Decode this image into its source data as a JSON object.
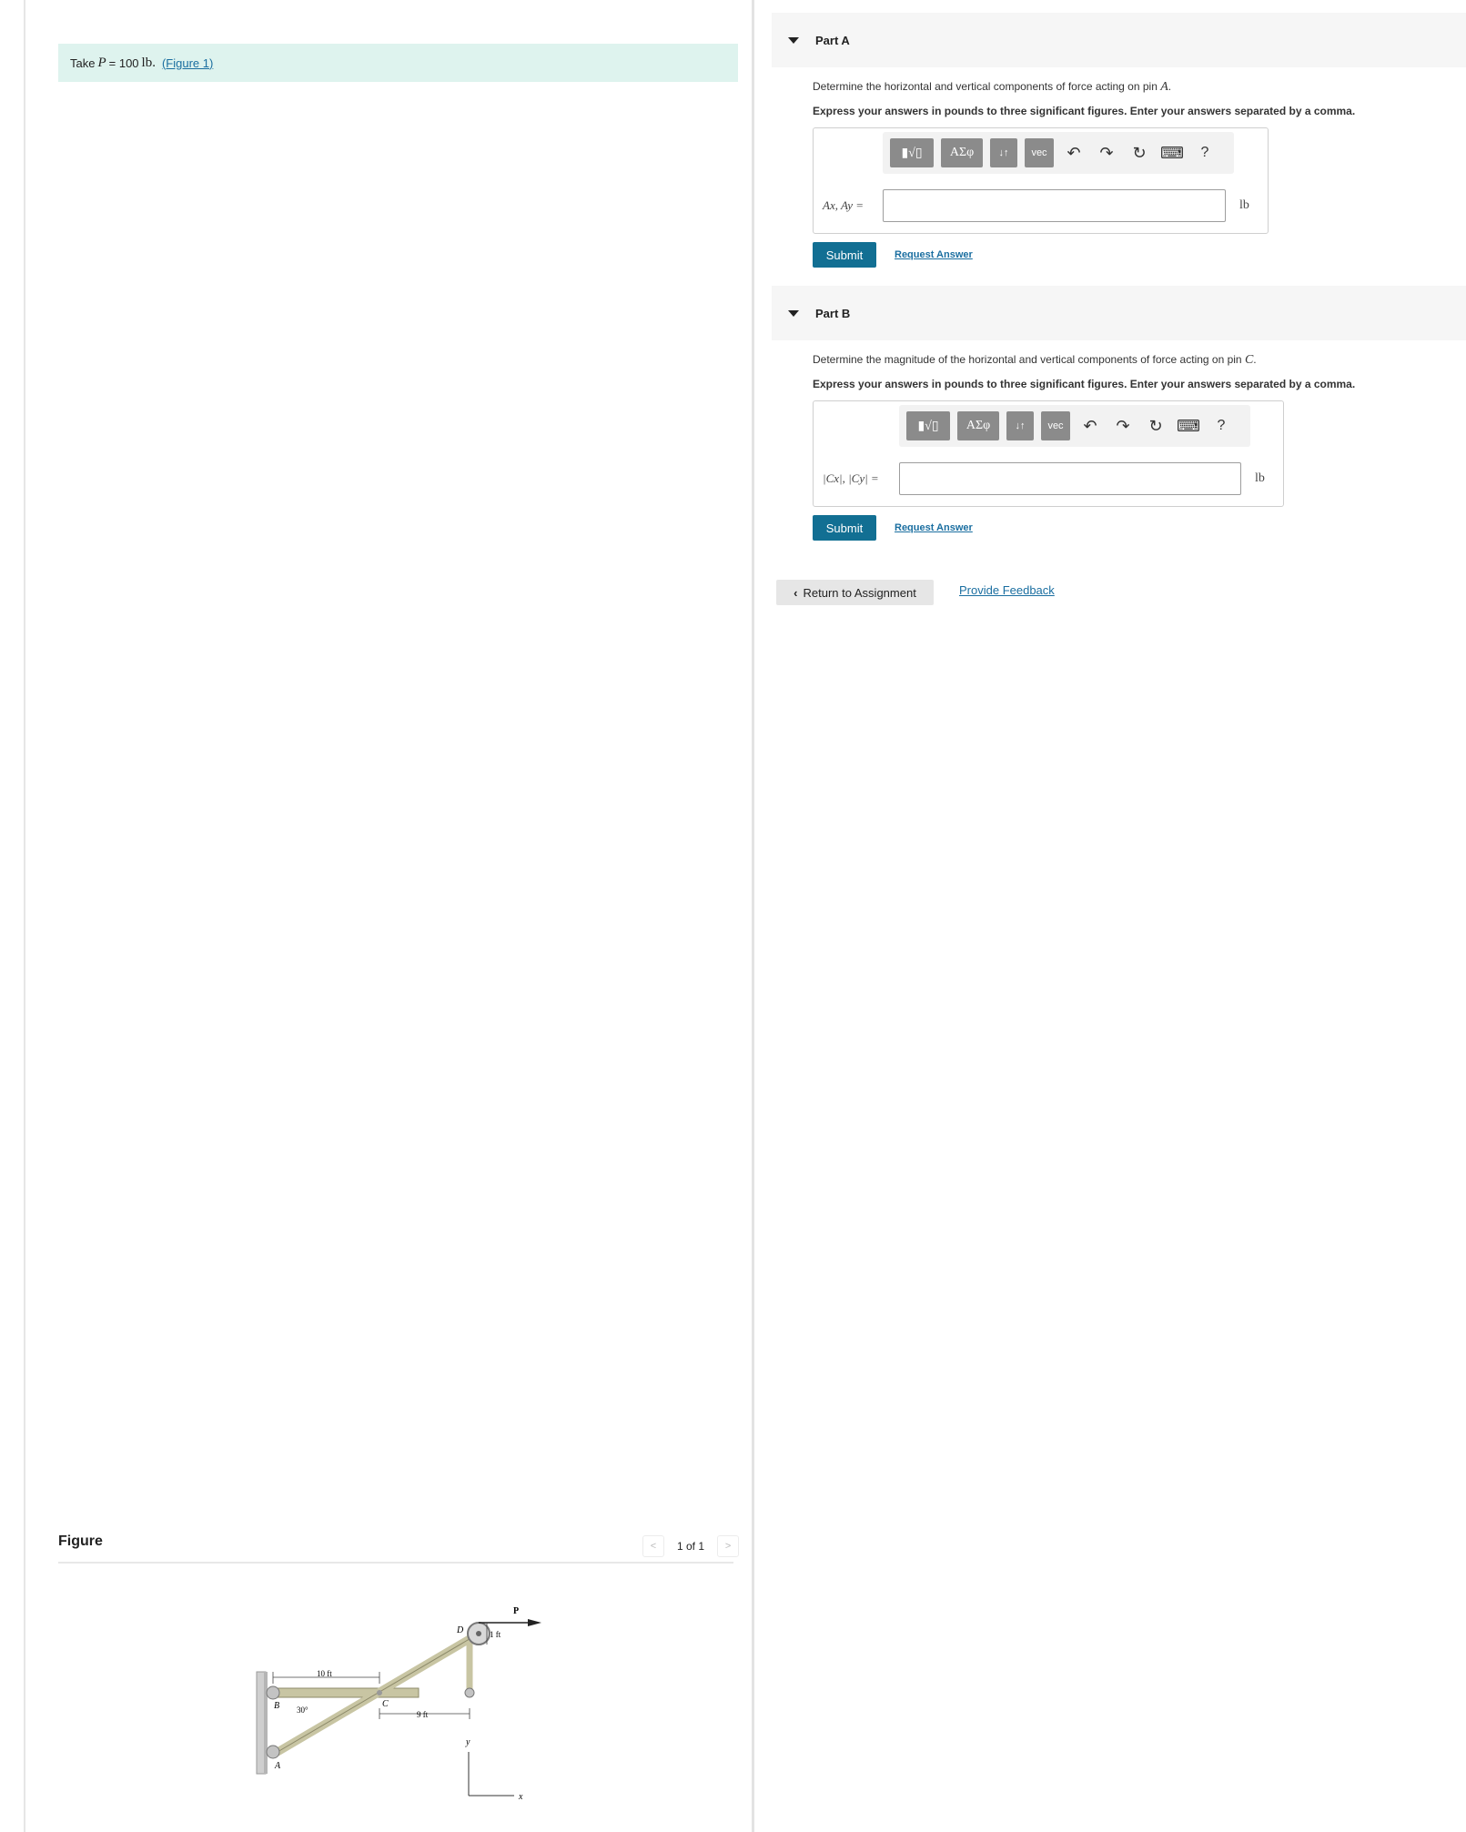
{
  "intro": {
    "take": "Take",
    "variable": "P",
    "equals_value": "= 100",
    "unit": "lb.",
    "figure_link": "(Figure 1)"
  },
  "figure": {
    "title": "Figure",
    "pager": "1 of 1",
    "prev": "<",
    "next": ">",
    "labels": {
      "P": "P",
      "D": "D",
      "one_ft": "1 ft",
      "ten_ft": "10 ft",
      "C": "C",
      "B": "B",
      "angle": "30°",
      "nine_ft": "9 ft",
      "y": "y",
      "A": "A",
      "x": "x"
    }
  },
  "parts": [
    {
      "title": "Part A",
      "question_prefix": "Determine the horizontal and vertical components of force acting on pin",
      "question_var": "A",
      "question_suffix": ".",
      "instructions": "Express your answers in pounds to three significant figures. Enter your answers separated by a comma.",
      "answer_label": "Ax, Ay =",
      "unit": "lb",
      "submit": "Submit",
      "request": "Request Answer"
    },
    {
      "title": "Part B",
      "question_prefix": "Determine the magnitude of the horizontal and vertical components of force acting on pin",
      "question_var": "C",
      "question_suffix": ".",
      "instructions": "Express your answers in pounds to three significant figures. Enter your answers separated by a comma.",
      "answer_label": "|Cx|, |Cy| =",
      "unit": "lb",
      "submit": "Submit",
      "request": "Request Answer"
    }
  ],
  "toolbar": {
    "template": "▮√▯",
    "greek": "ΑΣφ",
    "sort": "↓↑",
    "vec": "vec",
    "undo": "↶",
    "redo": "↷",
    "reset": "↻",
    "keyboard": "⌨",
    "help": "?"
  },
  "footer": {
    "return": "Return to Assignment",
    "feedback": "Provide Feedback"
  }
}
